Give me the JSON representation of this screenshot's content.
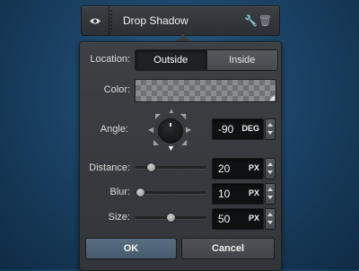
{
  "layer": {
    "title": "Drop Shadow",
    "eye_icon": "eye-icon",
    "wrench_icon": "wrench-icon",
    "trash_icon": "trash-icon"
  },
  "location": {
    "label": "Location:",
    "options": [
      "Outside",
      "Inside"
    ],
    "selected": "Outside"
  },
  "color": {
    "label": "Color:"
  },
  "angle": {
    "label": "Angle:",
    "value": "-90",
    "unit": "DEG"
  },
  "distance": {
    "label": "Distance:",
    "value": "20",
    "unit": "PX",
    "slider_fraction": 0.23
  },
  "blur": {
    "label": "Blur:",
    "value": "10",
    "unit": "PX",
    "slider_fraction": 0.08
  },
  "size": {
    "label": "Size:",
    "value": "50",
    "unit": "PX",
    "slider_fraction": 0.5
  },
  "buttons": {
    "ok": "OK",
    "cancel": "Cancel"
  },
  "colors": {
    "ok_accent": "#4f6479",
    "panel_bg": "#383b3f"
  }
}
